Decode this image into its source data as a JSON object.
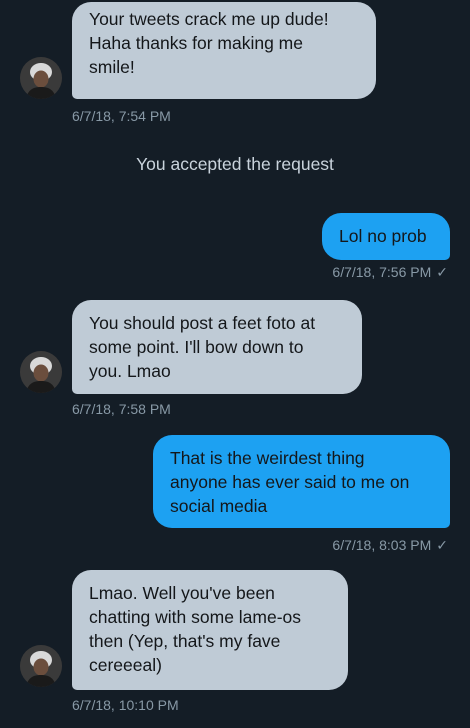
{
  "conversation": {
    "messages": [
      {
        "direction": "received",
        "text": "Your tweets crack me up dude!\nHaha thanks for making me\nsmile!",
        "timestamp": "6/7/18, 7:54 PM"
      },
      {
        "direction": "sent",
        "text": "Lol no prob",
        "timestamp": "6/7/18, 7:56 PM",
        "read_mark": "✓"
      },
      {
        "direction": "received",
        "text": "You should post a feet foto at\nsome point. I'll bow down to\nyou. Lmao",
        "timestamp": "6/7/18, 7:58 PM"
      },
      {
        "direction": "sent",
        "text": "That is the weirdest thing\nanyone has ever said to me on\nsocial media",
        "timestamp": "6/7/18, 8:03 PM",
        "read_mark": "✓"
      },
      {
        "direction": "received",
        "text": "Lmao. Well you've been\nchatting with some lame-os\nthen (Yep, that's my fave\ncereeeal)",
        "timestamp": "6/7/18, 10:10 PM"
      }
    ],
    "system_notice": "You accepted the request"
  },
  "colors": {
    "background": "#141d26",
    "received_bubble": "#bfcbd6",
    "sent_bubble": "#1da1f2",
    "timestamp": "#8899a6"
  }
}
